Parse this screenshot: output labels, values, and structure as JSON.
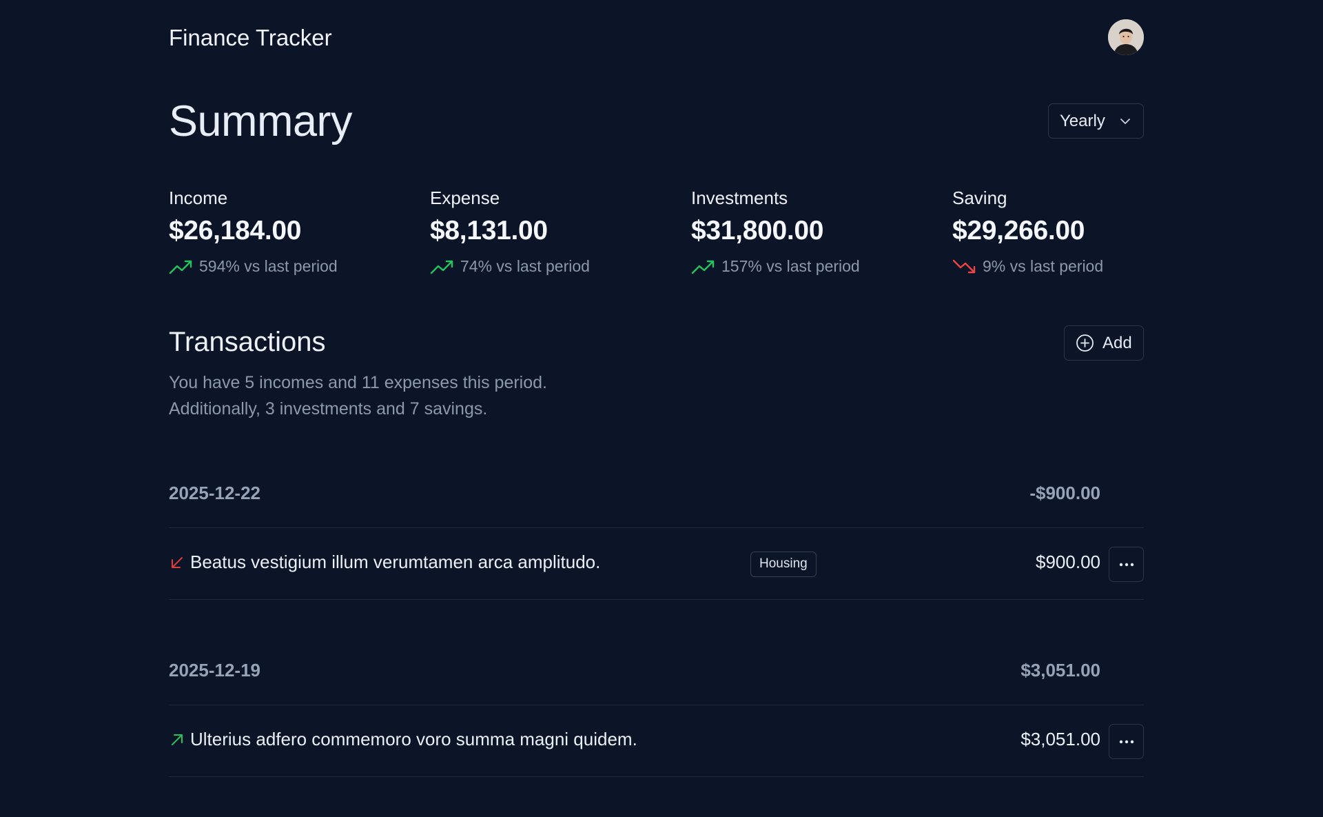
{
  "header": {
    "app_title": "Finance Tracker"
  },
  "summary": {
    "title": "Summary",
    "period": "Yearly",
    "stats": [
      {
        "label": "Income",
        "value": "$26,184.00",
        "trend": "594% vs last period",
        "direction": "up",
        "color": "#22c55e"
      },
      {
        "label": "Expense",
        "value": "$8,131.00",
        "trend": "74% vs last period",
        "direction": "up",
        "color": "#22c55e"
      },
      {
        "label": "Investments",
        "value": "$31,800.00",
        "trend": "157% vs last period",
        "direction": "up",
        "color": "#22c55e"
      },
      {
        "label": "Saving",
        "value": "$29,266.00",
        "trend": "9% vs last period",
        "direction": "down",
        "color": "#ef4444"
      }
    ]
  },
  "transactions": {
    "title": "Transactions",
    "add_label": "Add",
    "description_line1": "You have 5 incomes and 11 expenses this period.",
    "description_line2": "Additionally, 3 investments and 7 savings.",
    "groups": [
      {
        "date": "2025-12-22",
        "total": "-$900.00",
        "items": [
          {
            "description": "Beatus vestigium illum verumtamen arca amplitudo.",
            "category": "Housing",
            "amount": "$900.00",
            "direction": "expense",
            "icon": "arrow-down-left-icon"
          }
        ]
      },
      {
        "date": "2025-12-19",
        "total": "$3,051.00",
        "items": [
          {
            "description": "Ulterius adfero commemoro voro summa magni quidem.",
            "category": "",
            "amount": "$3,051.00",
            "direction": "income",
            "icon": "arrow-up-right-icon"
          }
        ]
      }
    ]
  },
  "colors": {
    "background": "#0c1527",
    "border": "#2a3550",
    "muted_text": "#8c98ad",
    "up": "#22c55e",
    "down": "#ef4444"
  }
}
